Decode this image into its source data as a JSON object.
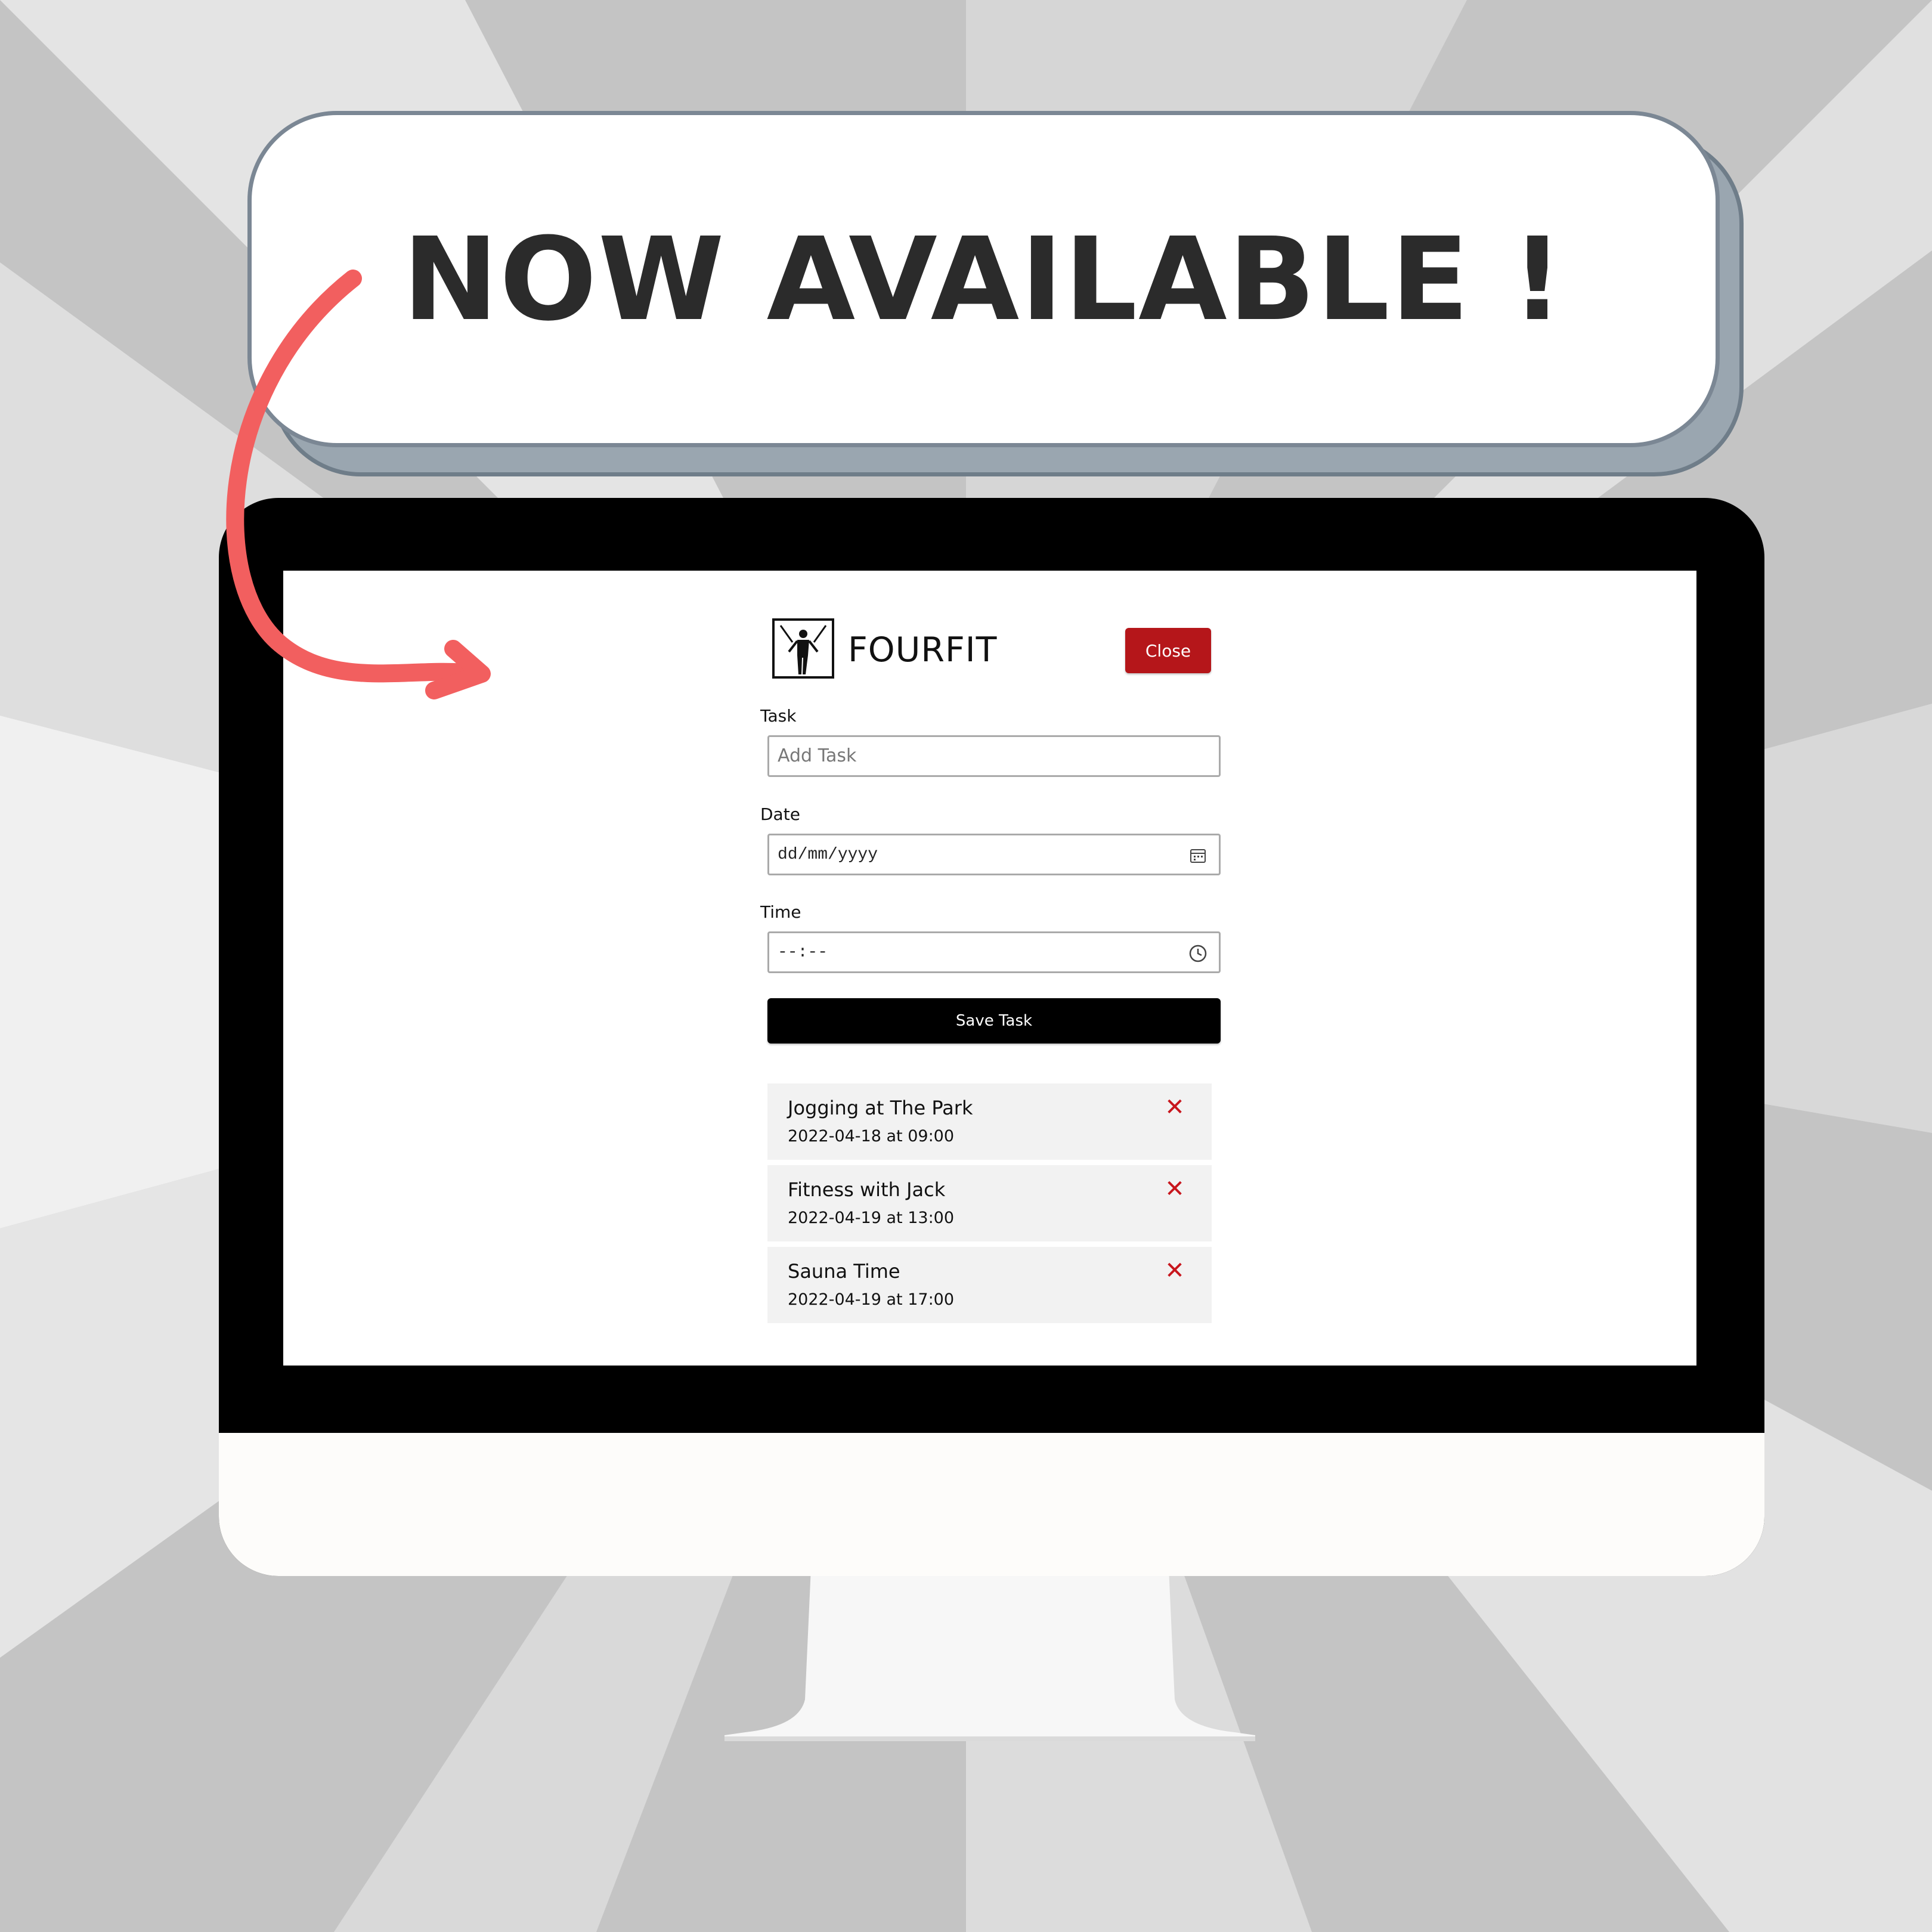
{
  "banner": {
    "headline": "NOW AVAILABLE !"
  },
  "app": {
    "logo_icon": "fitness-figure-icon",
    "title": "FOURFIT",
    "close_label": "Close",
    "task_label": "Task",
    "task_placeholder": "Add Task",
    "date_label": "Date",
    "date_value": "dd/mm/yyyy",
    "date_icon": "calendar-icon",
    "time_label": "Time",
    "time_value": "--:--",
    "time_icon": "clock-icon",
    "save_label": "Save Task",
    "tasks": [
      {
        "title": "Jogging at The Park",
        "when": "2022-04-18 at 09:00",
        "delete_icon": "close-icon"
      },
      {
        "title": "Fitness with Jack",
        "when": "2022-04-19 at 13:00",
        "delete_icon": "close-icon"
      },
      {
        "title": "Sauna Time",
        "when": "2022-04-19 at 17:00",
        "delete_icon": "close-icon"
      }
    ],
    "delete_glyph": "✕"
  },
  "colors": {
    "accent_red": "#b5161a",
    "arrow": "#f25f5f",
    "save_button": "#000000",
    "banner_border": "#7b8794"
  }
}
